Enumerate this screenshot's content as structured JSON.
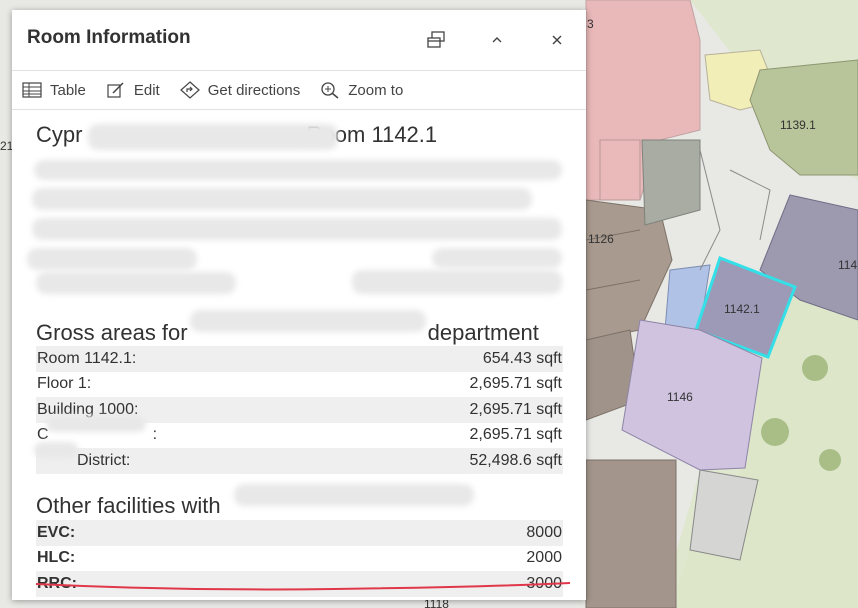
{
  "popup": {
    "title": "Room Information",
    "actions": [
      {
        "label": "Table"
      },
      {
        "label": "Edit"
      },
      {
        "label": "Get directions"
      },
      {
        "label": "Zoom to"
      }
    ],
    "feature_title_prefix": "Cypr",
    "feature_title_suffix": ", Room 1142.1",
    "gross_heading_prefix": "Gross areas for",
    "gross_heading_suffix": "department",
    "areas": [
      {
        "label": "Room 1142.1:",
        "value": "654.43 sqft"
      },
      {
        "label": "Floor 1:",
        "value": "2,695.71 sqft"
      },
      {
        "label": "Building 1000:",
        "value": "2,695.71 sqft"
      },
      {
        "label": "C",
        "label_suffix": ":",
        "value": "2,695.71 sqft"
      },
      {
        "label": "District:",
        "value": "52,498.6 sqft"
      }
    ],
    "facilities_heading": "Other facilities with",
    "facilities": [
      {
        "label": "EVC:",
        "value": "8000"
      },
      {
        "label": "HLC:",
        "value": "2000"
      },
      {
        "label": "RRC:",
        "value": "3000"
      }
    ]
  },
  "map": {
    "labels": [
      "1139.1",
      "1126",
      "1142.1",
      "1146",
      "114",
      "3",
      "21",
      "1118"
    ],
    "highlight_color": "#33e0e8"
  }
}
